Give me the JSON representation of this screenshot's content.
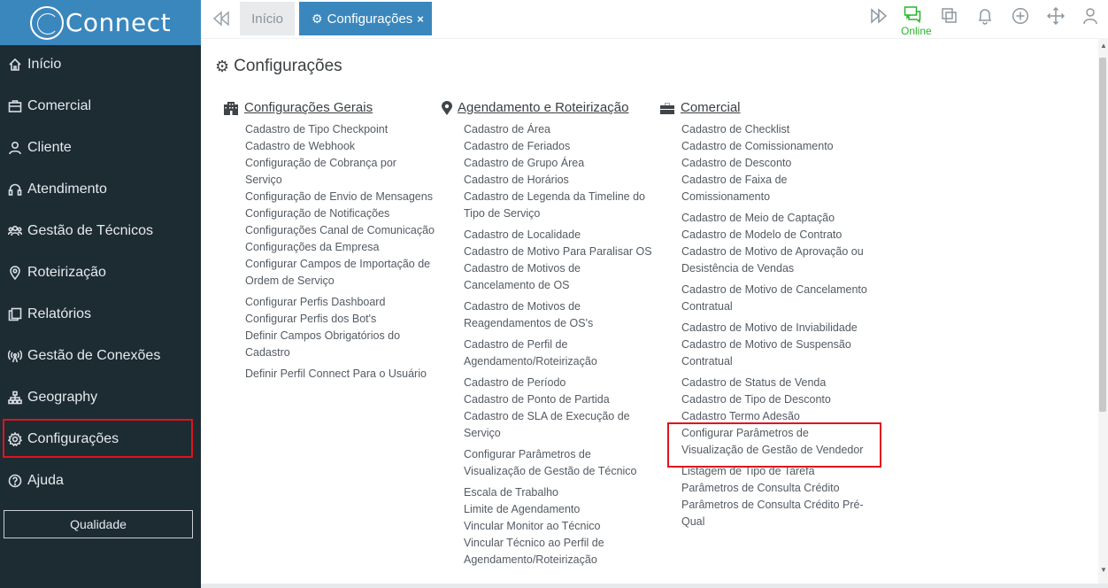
{
  "brand": {
    "logo_text": "Connect"
  },
  "sidebar": {
    "items": [
      {
        "label": "Início",
        "icon": "home-icon"
      },
      {
        "label": "Comercial",
        "icon": "briefcase-icon"
      },
      {
        "label": "Cliente",
        "icon": "user-icon"
      },
      {
        "label": "Atendimento",
        "icon": "headset-icon"
      },
      {
        "label": "Gestão de Técnicos",
        "icon": "users-icon"
      },
      {
        "label": "Roteirização",
        "icon": "map-pin-icon"
      },
      {
        "label": "Relatórios",
        "icon": "copy-icon"
      },
      {
        "label": "Gestão de Conexões",
        "icon": "antenna-icon"
      },
      {
        "label": "Geography",
        "icon": "sitemap-icon"
      },
      {
        "label": "Configurações",
        "icon": "gear-icon"
      },
      {
        "label": "Ajuda",
        "icon": "help-icon"
      }
    ],
    "quality_button": "Qualidade"
  },
  "tabs": {
    "home": "Início",
    "active": "Configurações",
    "close": "×"
  },
  "topbar": {
    "status": "Online"
  },
  "page": {
    "title": "Configurações"
  },
  "columns": {
    "gerais": {
      "title": "Configurações Gerais",
      "items": [
        "Cadastro de Tipo Checkpoint",
        "Cadastro de Webhook",
        "Configuração de Cobrança por Serviço",
        "Configuração de Envio de Mensagens",
        "Configuração de Notificações",
        "Configurações Canal de Comunicação",
        "Configurações da Empresa",
        "Configurar Campos de Importação de Ordem de Serviço",
        "Configurar Perfis Dashboard",
        "Configurar Perfis dos Bot's",
        "Definir Campos Obrigatórios do Cadastro",
        "Definir Perfil Connect Para o Usuário"
      ]
    },
    "agendamento": {
      "title": "Agendamento e Roteirização",
      "items": [
        "Cadastro de Área",
        "Cadastro de Feriados",
        "Cadastro de Grupo Área",
        "Cadastro de Horários",
        "Cadastro de Legenda da Timeline do Tipo de Serviço",
        "Cadastro de Localidade",
        "Cadastro de Motivo Para Paralisar OS",
        "Cadastro de Motivos de Cancelamento de OS",
        "Cadastro de Motivos de Reagendamentos de OS's",
        "Cadastro de Perfil de Agendamento/Roteirização",
        "Cadastro de Período",
        "Cadastro de Ponto de Partida",
        "Cadastro de SLA de Execução de Serviço",
        "Configurar Parâmetros de Visualização de Gestão de Técnico",
        "Escala de Trabalho",
        "Limite de Agendamento",
        "Vincular Monitor ao Técnico",
        "Vincular Técnico ao Perfil de Agendamento/Roteirização"
      ]
    },
    "comercial": {
      "title": "Comercial",
      "items": [
        "Cadastro de Checklist",
        "Cadastro de Comissionamento",
        "Cadastro de Desconto",
        "Cadastro de Faixa de Comissionamento",
        "Cadastro de Meio de Captação",
        "Cadastro de Modelo de Contrato",
        "Cadastro de Motivo de Aprovação ou Desistência de Vendas",
        "Cadastro de Motivo de Cancelamento Contratual",
        "Cadastro de Motivo de Inviabilidade",
        "Cadastro de Motivo de Suspensão Contratual",
        "Cadastro de Status de Venda",
        "Cadastro de Tipo de Desconto",
        "Cadastro Termo Adesão",
        "Configurar Parâmetros de Visualização de Gestão de Vendedor",
        "Listagem de Tipo de Tarefa",
        "Parâmetros de Consulta Crédito",
        "Parâmetros de Consulta Crédito Pré-Qual"
      ]
    }
  }
}
